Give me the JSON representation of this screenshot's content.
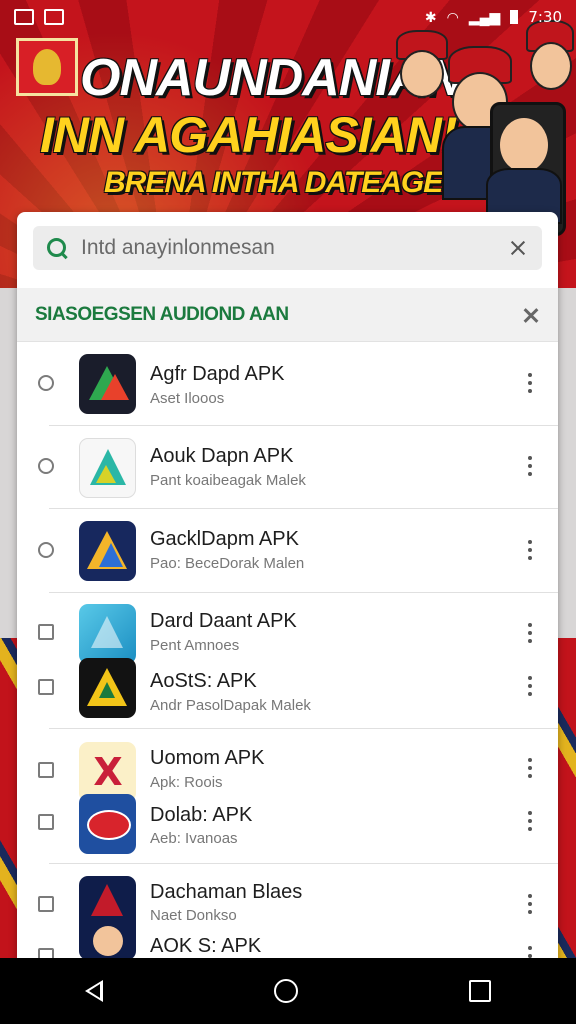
{
  "status_bar": {
    "time": "7:30"
  },
  "banner": {
    "line1": "ONAUNDANIAN",
    "line2": "INN AGAHIASIAN!",
    "line3": "BRENA INTHA DATEAGE"
  },
  "search": {
    "query": "Intd anayinlonmesan"
  },
  "section": {
    "title": "SIASOEGSEN AUDIOND AAN"
  },
  "apps": [
    {
      "name": "Agfr Dapd APK",
      "sub": "Aset Ilooos",
      "control": "radio"
    },
    {
      "name": "Aouk Dapn APK",
      "sub": "Pant koaibeagak Malek",
      "control": "radio"
    },
    {
      "name": "GacklDapm APK",
      "sub": "Pao: BeceDorak Malen",
      "control": "radio"
    },
    {
      "name": "Dard Daant APK",
      "sub": "Pent Amnoes",
      "control": "checkbox"
    },
    {
      "name": "AoStS: APK",
      "sub": "Andr PasolDapak Malek",
      "control": "checkbox"
    },
    {
      "name": "Uomom APK",
      "sub": "Apk: Roois",
      "control": "checkbox"
    },
    {
      "name": "Dolab: APK",
      "sub": "Aeb: Ivanoas",
      "control": "checkbox"
    },
    {
      "name": "Dachaman Blaes",
      "sub": "Naet Donkso",
      "control": "checkbox"
    },
    {
      "name": "AOK S: APK",
      "sub": "",
      "control": "checkbox"
    }
  ],
  "colors": {
    "accent": "#1b7a3e",
    "banner_red": "#c4141c",
    "banner_yellow": "#ffd21e"
  }
}
